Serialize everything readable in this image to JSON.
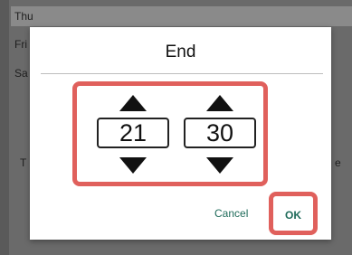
{
  "background": {
    "rows": [
      "Thu",
      "Fri",
      "Sa"
    ],
    "left_fragment": "T",
    "right_fragment": "e"
  },
  "dialog": {
    "title": "End",
    "hour": "21",
    "separator": ":",
    "minute": "30",
    "cancel_label": "Cancel",
    "ok_label": "OK"
  },
  "colors": {
    "highlight": "#e0605c",
    "button_text": "#1f6b5a"
  }
}
